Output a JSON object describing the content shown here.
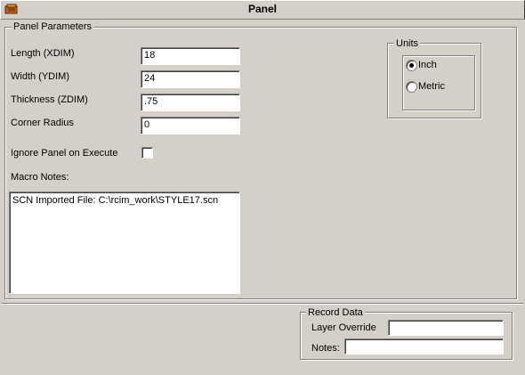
{
  "window": {
    "title": "Panel",
    "icon": "panel-app-icon"
  },
  "panel_parameters": {
    "group_label": "Panel Parameters",
    "length": {
      "label": "Length (XDIM)",
      "value": "18"
    },
    "width": {
      "label": "Width (YDIM)",
      "value": "24"
    },
    "thickness": {
      "label": "Thickness (ZDIM)",
      "value": ".75"
    },
    "corner_radius": {
      "label": "Corner Radius",
      "value": "0"
    },
    "ignore_panel": {
      "label": "Ignore Panel on Execute",
      "checked": false
    },
    "macro_notes": {
      "label": "Macro Notes:",
      "value": "SCN Imported File: C:\\rcim_work\\STYLE17.scn"
    }
  },
  "units": {
    "group_label": "Units",
    "options": [
      {
        "label": "Inch",
        "selected": true
      },
      {
        "label": "Metric",
        "selected": false
      }
    ]
  },
  "record_data": {
    "group_label": "Record Data",
    "layer_override": {
      "label": "Layer Override",
      "value": ""
    },
    "notes": {
      "label": "Notes:",
      "value": ""
    }
  }
}
